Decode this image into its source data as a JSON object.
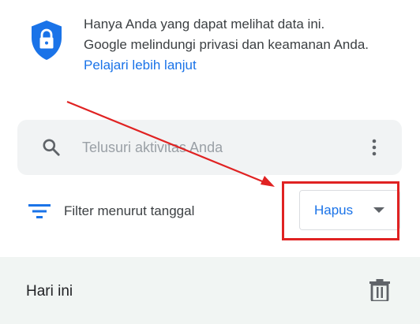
{
  "privacy": {
    "line1": "Hanya Anda yang dapat melihat data ini.",
    "line2": "Google melindungi privasi dan keamanan Anda.",
    "learn_more": "Pelajari lebih lanjut",
    "icon": "shield-lock-icon"
  },
  "search": {
    "placeholder": "Telusuri aktivitas Anda",
    "value": "",
    "icon": "search-icon",
    "menu_icon": "more-vert-icon"
  },
  "filter": {
    "label": "Filter menurut tanggal",
    "icon": "filter-icon"
  },
  "delete_menu": {
    "label": "Hapus",
    "icon": "caret-down-icon"
  },
  "today": {
    "label": "Hari ini",
    "icon": "trash-icon"
  },
  "colors": {
    "accent": "#1a73e8",
    "annotation": "#e02222",
    "search_bg": "#f1f3f4",
    "section_bg": "#f1f5f3"
  }
}
